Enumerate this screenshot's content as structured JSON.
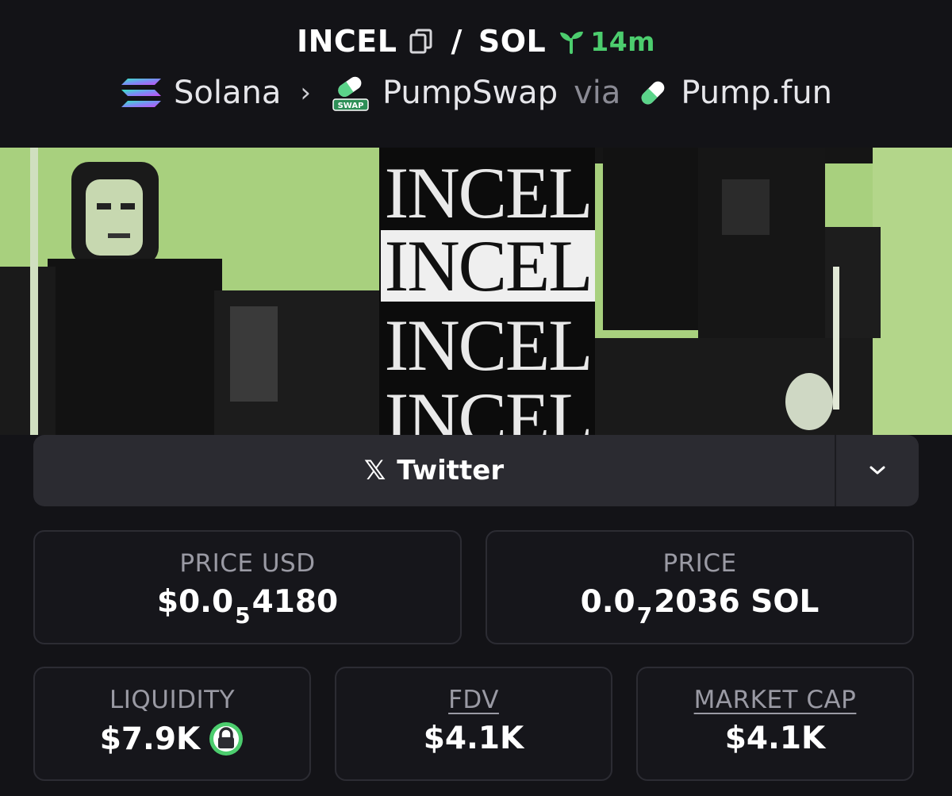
{
  "header": {
    "token": "INCEL",
    "separator": "/",
    "quote": "SOL",
    "age": "14m",
    "chain": "Solana",
    "dex": "PumpSwap",
    "via": "via",
    "launchpad": "Pump.fun",
    "swap_badge_text": "SWAP",
    "chain_chevron": "›"
  },
  "banner": {
    "words": [
      "INCEL",
      "INCEL",
      "INCEL",
      "INCEL"
    ]
  },
  "links": {
    "twitter_label": "Twitter",
    "x_glyph": "𝕏"
  },
  "stats": {
    "price_usd": {
      "label": "PRICE USD",
      "prefix": "$0.0",
      "zeros": "5",
      "digits": "4180"
    },
    "price": {
      "label": "PRICE",
      "prefix": "0.0",
      "zeros": "7",
      "digits": "2036 SOL"
    },
    "liquidity": {
      "label": "LIQUIDITY",
      "value": "$7.9K"
    },
    "fdv": {
      "label": "FDV",
      "value": "$4.1K"
    },
    "market_cap": {
      "label": "MARKET CAP",
      "value": "$4.1K"
    }
  },
  "colors": {
    "accent_green": "#4ccd6e",
    "background": "#131317",
    "card_border": "#2c2c33",
    "banner_green": "#a8d07e"
  },
  "icons": [
    "copy-icon",
    "sprout-icon",
    "solana-logo",
    "pumpswap-logo",
    "pill-icon",
    "x-icon",
    "chevron-down-icon",
    "lock-icon"
  ]
}
